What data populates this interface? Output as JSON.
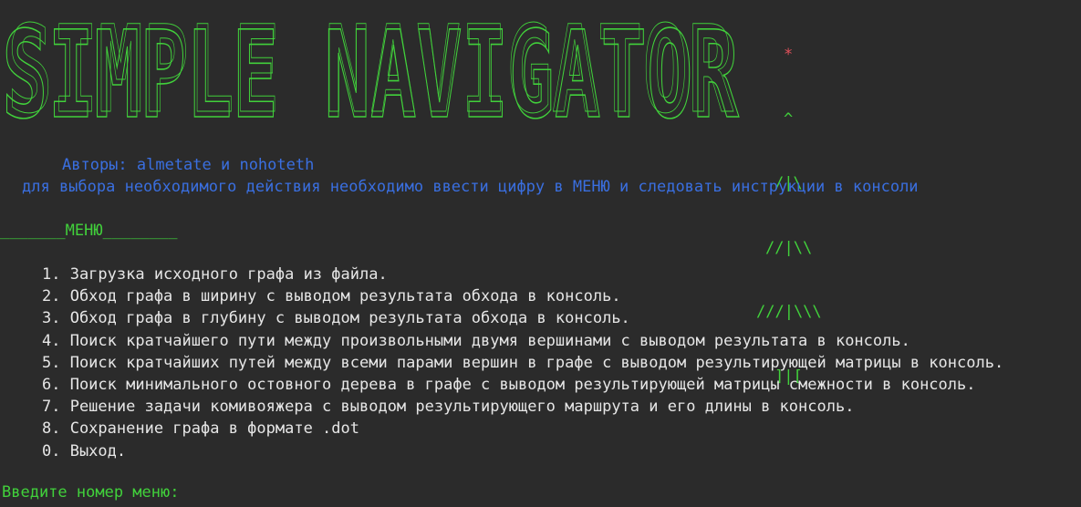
{
  "banner": {
    "title": "SIMPLE NAVIGATOR",
    "tree_lines": [
      "*",
      "^",
      "/|\\",
      "//|\\\\",
      "///|\\\\\\",
      "]|["
    ]
  },
  "info": {
    "authors": "Авторы: almetate и nohoteth",
    "instruction": "для выбора необходимого действия необходимо ввести цифру в МЕНЮ и следовать инструкции в консоли"
  },
  "menu": {
    "header": "_______МЕНЮ________",
    "items": [
      "1. Загрузка исходного графа из файла.",
      "2. Обход графа в ширину с выводом результата обхода в консоль.",
      "3. Обход графа в глубину с выводом результата обхода в консоль.",
      "4. Поиск кратчайшего пути между произвольными двумя вершинами с выводом результата в консоль.",
      "5. Поиск кратчайших путей между всеми парами вершин в графе с выводом результирующей матрицы в консоль.",
      "6. Поиск минимального остовного дерева в графе с выводом результирующей матрицы смежности в консоль.",
      "7. Решение задачи комивояжера с выводом результирующего маршрута и его длины в консоль.",
      "8. Сохранение графа в формате .dot",
      "0. Выход."
    ]
  },
  "prompt": {
    "text": "Введите номер меню:"
  },
  "colors": {
    "background": "#2b2b2b",
    "green": "#41d13b",
    "blue": "#3a6fe0",
    "text": "#e6e6e6",
    "star": "#e0505a"
  }
}
